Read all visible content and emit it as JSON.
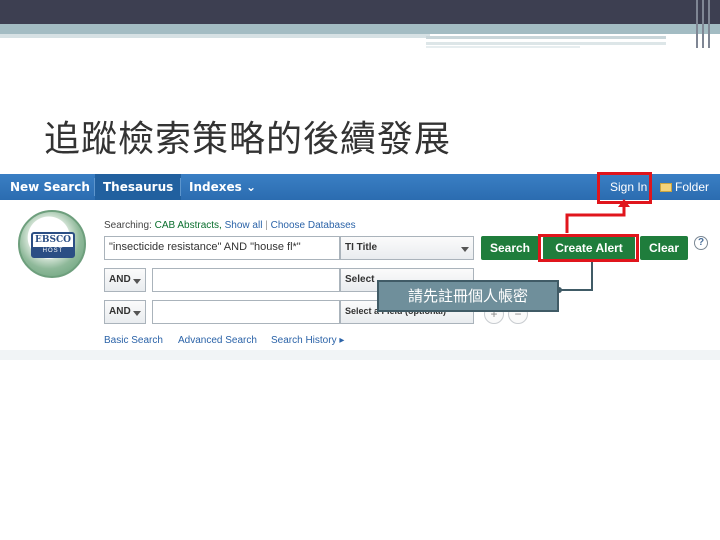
{
  "slide": {
    "title": "追蹤檢索策略的後續發展"
  },
  "nav": {
    "new_search": "New Search",
    "thesaurus": "Thesaurus",
    "indexes": "Indexes",
    "indexes_caret": "⌄",
    "sign_in": "Sign In",
    "folder": "Folder"
  },
  "logo": {
    "top": "EBSCO",
    "bottom": "HOST"
  },
  "search": {
    "searching_label": "Searching:",
    "database": "CAB Abstracts,",
    "show_all": "Show all",
    "choose_db": "Choose Databases",
    "query": "\"insecticide resistance\" AND \"house fl*\"",
    "field1": "TI Title",
    "bool2": "AND",
    "field2": "Select",
    "bool3": "AND",
    "field3": "Select a Field (optional)",
    "search_btn": "Search",
    "create_alert_btn": "Create Alert",
    "clear_btn": "Clear",
    "help": "?"
  },
  "links": {
    "basic": "Basic Search",
    "advanced": "Advanced Search",
    "history": "Search History ▸"
  },
  "callout": {
    "text": "請先註冊個人帳密"
  },
  "colors": {
    "nav": "#2b6cb0",
    "button": "#1f7d3c",
    "highlight": "#e0151c"
  }
}
